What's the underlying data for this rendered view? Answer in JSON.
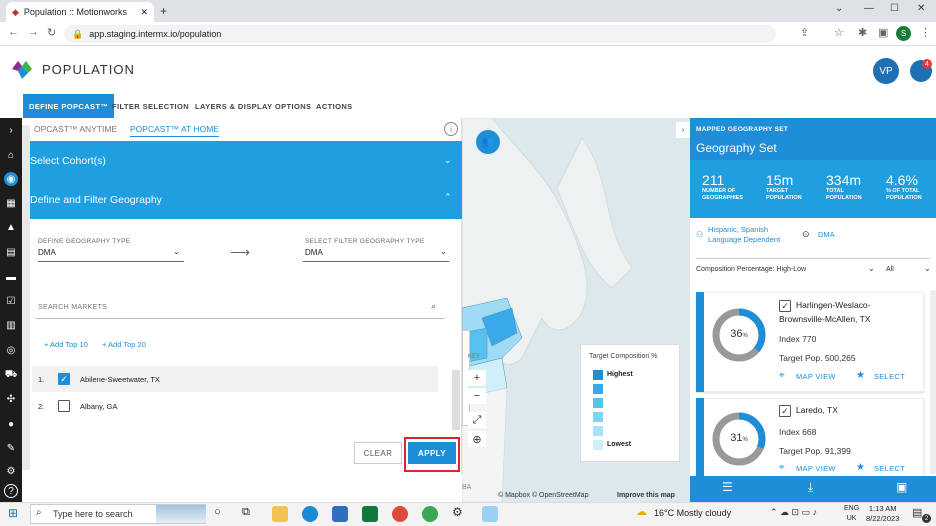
{
  "browser": {
    "tab_title": "Population :: Motionworks",
    "url": "app.staging.intermx.io/population",
    "profile_initial": "S"
  },
  "app": {
    "title": "POPULATION",
    "avatar_initials": "VP",
    "notification_count": "4"
  },
  "nav_tabs": [
    {
      "label": "DEFINE POPCAST™",
      "active": true
    },
    {
      "label": "FILTER SELECTION",
      "active": false
    },
    {
      "label": "LAYERS & DISPLAY OPTIONS",
      "active": false
    },
    {
      "label": "ACTIONS",
      "active": false
    }
  ],
  "left_panel": {
    "subtabs": [
      {
        "label": "OPCAST™ ANYTIME",
        "active": false
      },
      {
        "label": "POPCAST™ AT HOME",
        "active": true
      }
    ],
    "accordion_cohorts": "Select Cohort(s)",
    "accordion_geo": "Define and Filter Geography",
    "define_geo_label": "DEFINE GEOGRAPHY TYPE",
    "define_geo_value": "DMA",
    "filter_geo_label": "SELECT FILTER GEOGRAPHY TYPE",
    "filter_geo_value": "DMA",
    "search_placeholder": "SEARCH MARKETS",
    "add_top10": "+ Add Top 10",
    "add_top20": "+ Add Top 20",
    "markets": [
      {
        "num": "1.",
        "name": "Abilene-Sweetwater, TX",
        "checked": true
      },
      {
        "num": "2.",
        "name": "Albany, GA",
        "checked": false
      }
    ],
    "clear_label": "CLEAR",
    "apply_label": "APPLY"
  },
  "map": {
    "legend_title": "Target Composition %",
    "legend_high": "Highest",
    "legend_low": "Lowest",
    "legend_colors": [
      "#1f8ed8",
      "#3aa9ea",
      "#5ac0f0",
      "#7fd3f5",
      "#a6e3f8",
      "#cfeffb"
    ],
    "key_label": "KEY",
    "attribution": "© Mapbox © OpenStreetMap",
    "improve": "Improve this map",
    "partial_label": "BA"
  },
  "right_panel": {
    "subtitle": "MAPPED GEOGRAPHY SET",
    "title": "Geography Set",
    "stats": [
      {
        "value": "211",
        "label1": "NUMBER OF",
        "label2": "GEOGRAPHIES"
      },
      {
        "value": "15m",
        "label1": "TARGET",
        "label2": "POPULATION"
      },
      {
        "value": "334m",
        "label1": "TOTAL",
        "label2": "POPULATION"
      },
      {
        "value": "4.6%",
        "label1": "% OF TOTAL",
        "label2": "POPULATION"
      }
    ],
    "audience_tag1": "Hispanic, Spanish",
    "audience_tag2": "Language Dependent",
    "geo_tag": "DMA",
    "sort_label": "Composition Percentage: High-Low",
    "filter_label": "All",
    "cards": [
      {
        "name1": "Harlingen-Weslaco-",
        "name2": "Brownsville-McAllen, TX",
        "percent": "36",
        "percent_value": 36,
        "index": "Index 770",
        "target": "Target Pop. 500,265",
        "map_view": "MAP VIEW",
        "select": "SELECT"
      },
      {
        "name1": "Laredo, TX",
        "name2": "",
        "percent": "31",
        "percent_value": 31,
        "index": "Index 668",
        "target": "Target Pop. 91,399",
        "map_view": "MAP VIEW",
        "select": "SELECT"
      }
    ]
  },
  "taskbar": {
    "search_placeholder": "Type here to search",
    "weather": "16°C  Mostly cloudy",
    "lang1": "ENG",
    "lang2": "UK",
    "time": "1:13 AM",
    "date": "8/22/2023",
    "notif_count": "2"
  }
}
